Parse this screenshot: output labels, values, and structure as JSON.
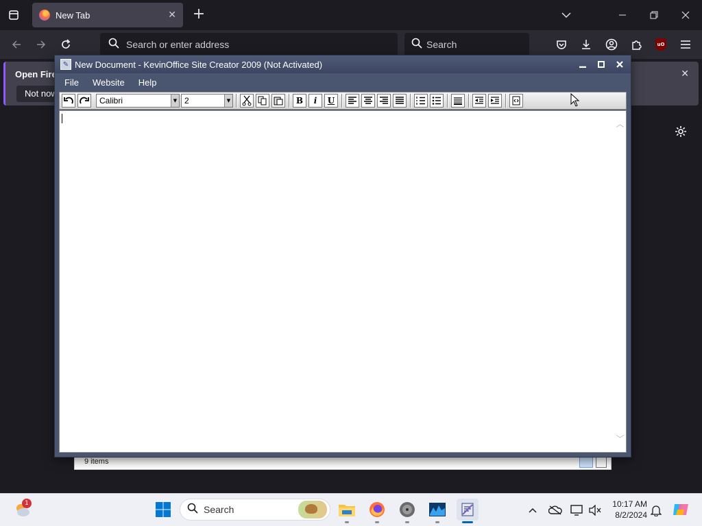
{
  "browser": {
    "tab": {
      "title": "New Tab"
    },
    "urlbar": {
      "placeholder": "Search or enter address"
    },
    "searchbar": {
      "placeholder": "Search"
    },
    "notification": {
      "title": "Open Firef",
      "button": "Not now"
    }
  },
  "explorer": {
    "status": "9 items"
  },
  "app": {
    "title": "New Document - KevinOffice Site Creator 2009 (Not Activated)",
    "menu": [
      "File",
      "Website",
      "Help"
    ],
    "toolbar": {
      "font": "Calibri",
      "size": "2",
      "bold": "B",
      "italic": "i",
      "underline": "U"
    },
    "content": ""
  },
  "taskbar": {
    "search_label": "Search",
    "weather_badge": "1",
    "time": "10:17 AM",
    "date": "8/2/2024"
  },
  "colors": {
    "accent": "#0067c0",
    "window_frame": "#4a5570",
    "browser_bg": "#1c1b22"
  }
}
